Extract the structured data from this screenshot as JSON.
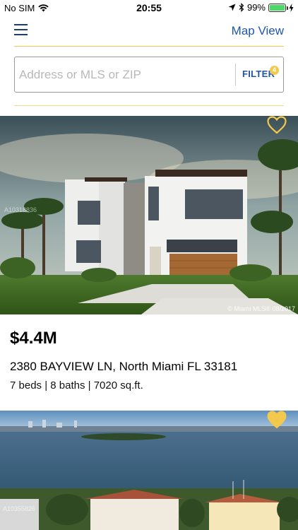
{
  "status_bar": {
    "carrier": "No SIM",
    "time": "20:55",
    "battery_percent": "99%",
    "battery_level": 0.99,
    "battery_color": "#4cd964"
  },
  "nav": {
    "menu_icon": "hamburger-icon",
    "map_view_label": "Map View"
  },
  "search": {
    "placeholder": "Address or MLS or ZIP",
    "value": "",
    "filter_label": "FILTER",
    "filter_badge": "4"
  },
  "colors": {
    "accent_blue": "#1f56a8",
    "accent_gold": "#f2c94c"
  },
  "listings": [
    {
      "price": "$4.4M",
      "address": "2380 BAYVIEW LN, North Miami FL 33181",
      "details": "7 beds | 8 baths | 7020 sq.ft.",
      "favorite": false,
      "photo_mls_id": "A10318836",
      "photo_credit": "© Miami MLS® 08/2017"
    },
    {
      "favorite": true,
      "photo_mls_id": "A10355826"
    }
  ]
}
